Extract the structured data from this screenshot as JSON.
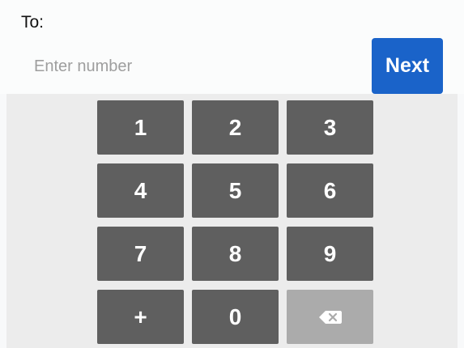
{
  "recipient": {
    "label": "To:",
    "value": "",
    "placeholder": "Enter number"
  },
  "next_button": {
    "label": "Next"
  },
  "keypad": {
    "keys": [
      {
        "label": "1",
        "name": "key-1",
        "icon": ""
      },
      {
        "label": "2",
        "name": "key-2",
        "icon": ""
      },
      {
        "label": "3",
        "name": "key-3",
        "icon": ""
      },
      {
        "label": "4",
        "name": "key-4",
        "icon": ""
      },
      {
        "label": "5",
        "name": "key-5",
        "icon": ""
      },
      {
        "label": "6",
        "name": "key-6",
        "icon": ""
      },
      {
        "label": "7",
        "name": "key-7",
        "icon": ""
      },
      {
        "label": "8",
        "name": "key-8",
        "icon": ""
      },
      {
        "label": "9",
        "name": "key-9",
        "icon": ""
      },
      {
        "label": "+",
        "name": "key-plus",
        "icon": ""
      },
      {
        "label": "0",
        "name": "key-0",
        "icon": ""
      },
      {
        "label": "",
        "name": "backspace-key",
        "icon": "backspace-icon"
      }
    ]
  },
  "colors": {
    "accent": "#1a63c9",
    "key": "#5f5f5f",
    "backspace_key": "#ababab",
    "keypad_background": "#ececec",
    "header_background": "#fbfcfc"
  }
}
